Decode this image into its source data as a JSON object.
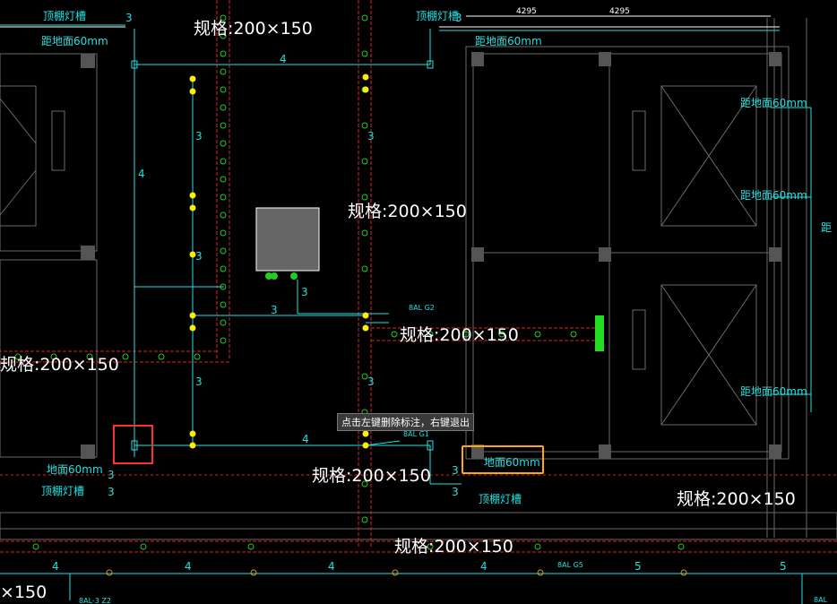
{
  "prompt": {
    "text": "点击左键删除标注，右键退出"
  },
  "labels": {
    "spec_top": "规格:200×150",
    "spec_mid": "规格:200×150",
    "spec_tray": "规格:200×150",
    "spec_left": "规格:200×150",
    "spec_bottom_mid": "规格:200×150",
    "spec_bottom_right": "规格:200×150",
    "spec_bottom": "规格:200×150",
    "spec_bottom_left": "×150",
    "ceiling_trough_1": "顶棚灯槽",
    "ceiling_trough_2": "顶棚灯槽",
    "ceiling_trough_3": "顶棚灯槽",
    "ceiling_trough_4": "顶棚灯槽",
    "dist_1": "距地面60mm",
    "dist_2": "距地面60mm",
    "dist_3": "距地面60mm",
    "dist_4": "距地面60mm",
    "dist_5": "距地面60mm",
    "dist_6": "地面60mm",
    "dist_7": "距",
    "dist_highlight": "地面60mm",
    "dim_1": "4295",
    "dim_2": "4295",
    "circuit_g2": "8AL G2",
    "circuit_g1": "8AL G1",
    "circuit_g5": "8AL G5",
    "circuit_bottom_left": "8AL-3 Z2",
    "circuit_right_small": "8AL",
    "num_3": "3",
    "num_4": "4",
    "num_5": "5"
  },
  "colors": {
    "background": "#000000",
    "cyan": "#22e0e0",
    "red": "#e02020",
    "green_circle": "#22cc22",
    "yellow": "#ffee00",
    "gray_wall": "#6a6a6a",
    "highlight_red": "#ff3030",
    "highlight_orange": "#ffaa00"
  }
}
